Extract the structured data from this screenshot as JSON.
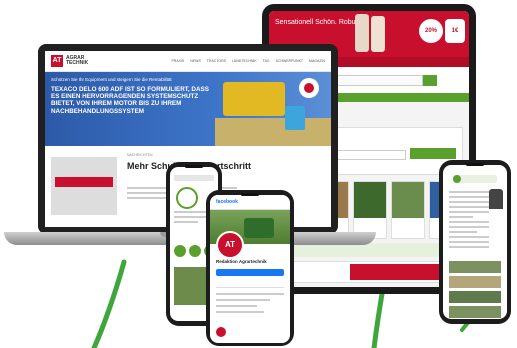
{
  "tablet": {
    "ad_text": "Sensationell Schön. Robust.",
    "discount": "20%",
    "currency_badge": "1€"
  },
  "laptop": {
    "logo_mark": "AT",
    "logo_line1": "AGRAR",
    "logo_line2": "TECHNIK",
    "nav": [
      "PRAXIS",
      "NEWS",
      "TRACTORS",
      "LANDTECHNIK",
      "TAG",
      "SCHWERPUNKT",
      "MAGAZIN"
    ],
    "hero_sub": "Schützen Sie Ihr Equipment und steigern Sie die Rentabilität",
    "hero_headline": "TEXACO DELO 600 ADF IST SO FORMULIERT, DASS ES EINEN HERVORRAGENDEN SYSTEMSCHUTZ BIETET, VON IHREM MOTOR BIS ZU IHREM NACHBEHANDLUNGSSYSTEM",
    "article_title": "Mehr Schub durch fortschritt",
    "article_meta": "NACHRICHTEN"
  },
  "phone_fb": {
    "app": "facebook",
    "avatar": "AT",
    "page_name": "Redaktion Agrartechnik"
  },
  "colors": {
    "brand_red": "#c8102e",
    "hero_blue": "#2c5aa8",
    "accent_green": "#5aa02c",
    "facebook_blue": "#1877f2"
  }
}
